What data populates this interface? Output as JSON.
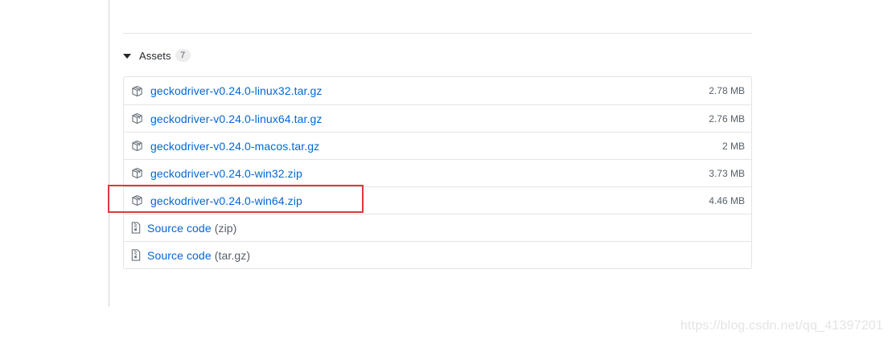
{
  "assets": {
    "title": "Assets",
    "count": "7",
    "files": [
      {
        "name": "geckodriver-v0.24.0-linux32.tar.gz",
        "size": "2.78 MB",
        "icon": "package-icon"
      },
      {
        "name": "geckodriver-v0.24.0-linux64.tar.gz",
        "size": "2.76 MB",
        "icon": "package-icon"
      },
      {
        "name": "geckodriver-v0.24.0-macos.tar.gz",
        "size": "2 MB",
        "icon": "package-icon"
      },
      {
        "name": "geckodriver-v0.24.0-win32.zip",
        "size": "3.73 MB",
        "icon": "package-icon"
      },
      {
        "name": "geckodriver-v0.24.0-win64.zip",
        "size": "4.46 MB",
        "icon": "package-icon"
      }
    ],
    "source": [
      {
        "label": "Source code",
        "format": "(zip)",
        "icon": "file-zip-icon"
      },
      {
        "label": "Source code",
        "format": "(tar.gz)",
        "icon": "file-zip-icon"
      }
    ]
  },
  "annotation": {
    "highlight_color": "#e0373b",
    "highlighted_item": "geckodriver-v0.24.0-win64.zip"
  },
  "watermark": "https://blog.csdn.net/qq_41397201",
  "colors": {
    "link": "#0366d6",
    "muted": "#586069",
    "border": "#e1e4e8"
  }
}
